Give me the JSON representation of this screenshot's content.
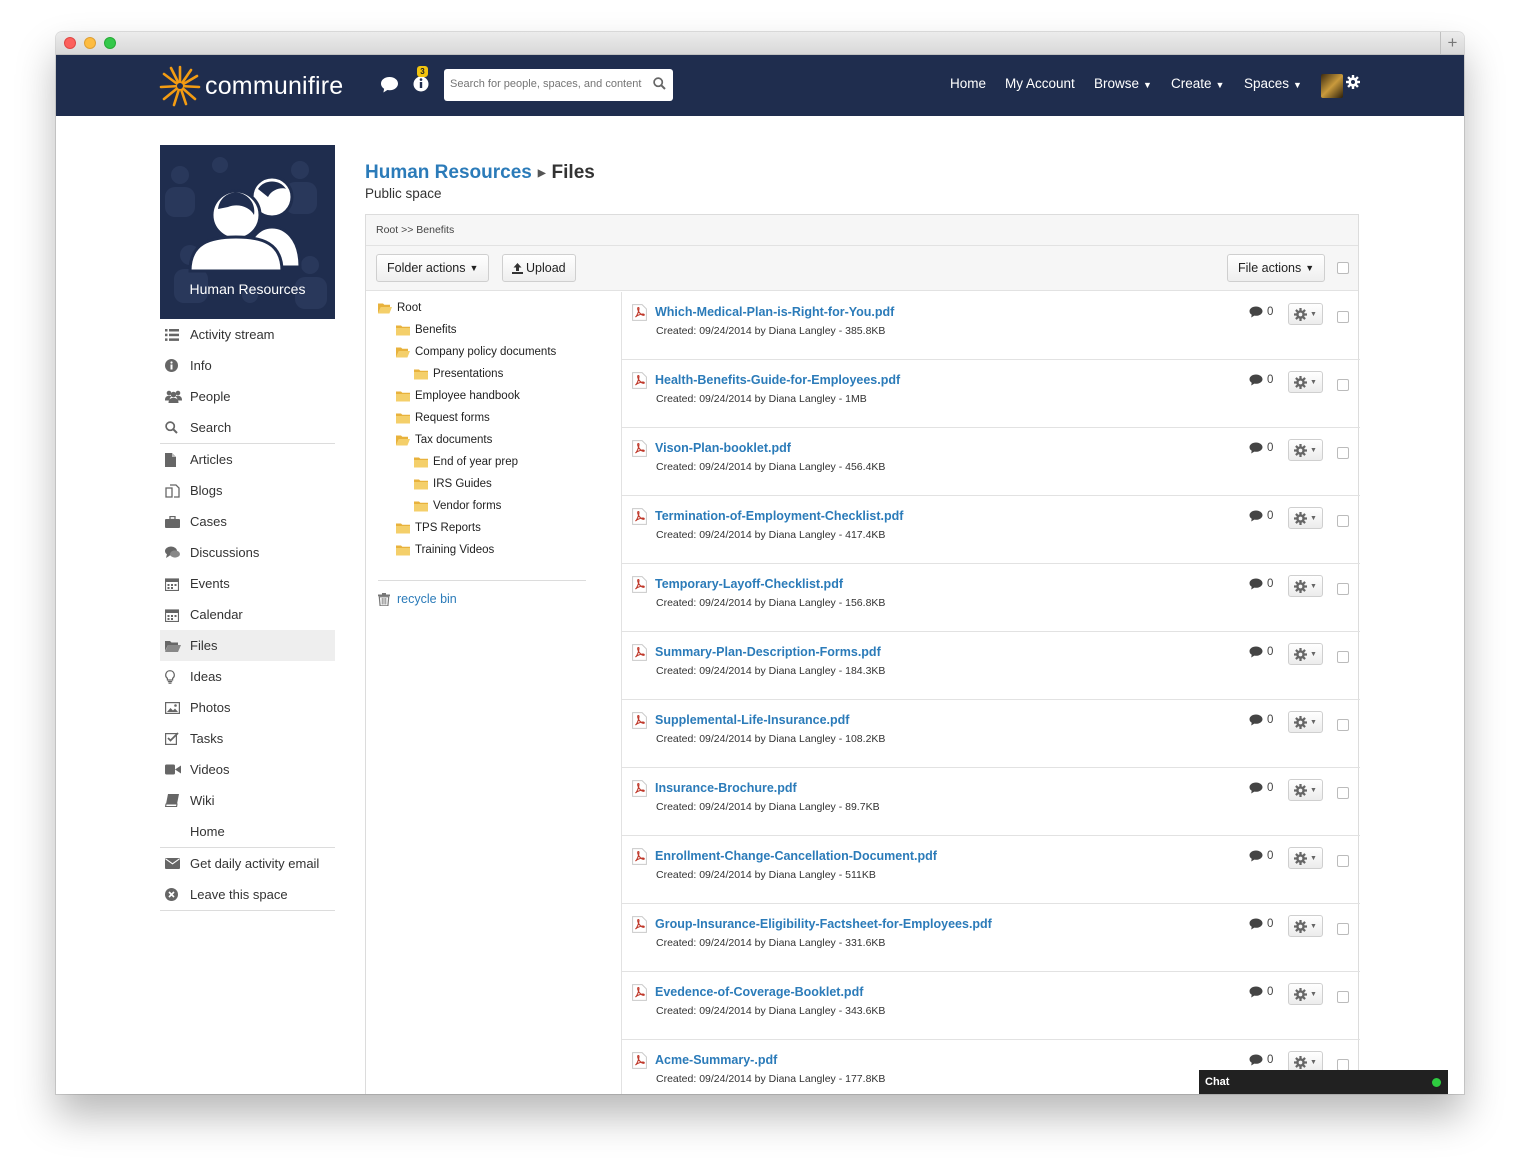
{
  "window": {
    "new_tab": "+"
  },
  "topnav": {
    "logo_text": "communifire",
    "notification_count": "3",
    "search_placeholder": "Search for people, spaces, and content",
    "menu": [
      {
        "label": "Home"
      },
      {
        "label": "My Account"
      },
      {
        "label": "Browse"
      },
      {
        "label": "Create"
      },
      {
        "label": "Spaces"
      }
    ]
  },
  "space": {
    "name": "Human Resources",
    "heading_link": "Human Resources",
    "heading_current": "Files",
    "visibility": "Public space"
  },
  "sidebar": {
    "items": [
      {
        "label": "Activity stream",
        "icon": "list-icon"
      },
      {
        "label": "Info",
        "icon": "info-icon"
      },
      {
        "label": "People",
        "icon": "people-icon"
      },
      {
        "label": "Search",
        "icon": "search-icon"
      },
      {
        "label": "Articles",
        "icon": "document-icon"
      },
      {
        "label": "Blogs",
        "icon": "blog-icon"
      },
      {
        "label": "Cases",
        "icon": "briefcase-icon"
      },
      {
        "label": "Discussions",
        "icon": "comments-icon"
      },
      {
        "label": "Events",
        "icon": "calendar-icon"
      },
      {
        "label": "Calendar",
        "icon": "calendar-icon"
      },
      {
        "label": "Files",
        "icon": "folder-open-icon"
      },
      {
        "label": "Ideas",
        "icon": "lightbulb-icon"
      },
      {
        "label": "Photos",
        "icon": "photo-icon"
      },
      {
        "label": "Tasks",
        "icon": "checkbox-icon"
      },
      {
        "label": "Videos",
        "icon": "video-icon"
      },
      {
        "label": "Wiki",
        "icon": "book-icon"
      },
      {
        "label": "Home",
        "icon": ""
      }
    ],
    "bottom": [
      {
        "label": "Get daily activity email",
        "icon": "envelope-icon"
      },
      {
        "label": "Leave this space",
        "icon": "remove-circle-icon"
      }
    ]
  },
  "toolbar": {
    "path": "Root >> Benefits",
    "folder_actions": "Folder actions",
    "upload": "Upload",
    "file_actions": "File actions"
  },
  "tree": {
    "items": [
      {
        "label": "Root",
        "open": true
      },
      {
        "label": "Benefits",
        "open": false
      },
      {
        "label": "Company policy documents",
        "open": true
      },
      {
        "label": "Presentations",
        "open": false
      },
      {
        "label": "Employee handbook",
        "open": false
      },
      {
        "label": "Request forms",
        "open": false
      },
      {
        "label": "Tax documents",
        "open": true
      },
      {
        "label": "End of year prep",
        "open": false
      },
      {
        "label": "IRS Guides",
        "open": false
      },
      {
        "label": "Vendor forms",
        "open": false
      },
      {
        "label": "TPS Reports",
        "open": false
      },
      {
        "label": "Training Videos",
        "open": false
      }
    ],
    "recycle_bin": "recycle bin"
  },
  "files": [
    {
      "name": "Which-Medical-Plan-is-Right-for-You.pdf",
      "meta": "Created: 09/24/2014 by Diana Langley - 385.8KB",
      "comments": "0"
    },
    {
      "name": "Health-Benefits-Guide-for-Employees.pdf",
      "meta": "Created: 09/24/2014 by Diana Langley - 1MB",
      "comments": "0"
    },
    {
      "name": "Vison-Plan-booklet.pdf",
      "meta": "Created: 09/24/2014 by Diana Langley - 456.4KB",
      "comments": "0"
    },
    {
      "name": "Termination-of-Employment-Checklist.pdf",
      "meta": "Created: 09/24/2014 by Diana Langley - 417.4KB",
      "comments": "0"
    },
    {
      "name": "Temporary-Layoff-Checklist.pdf",
      "meta": "Created: 09/24/2014 by Diana Langley - 156.8KB",
      "comments": "0"
    },
    {
      "name": "Summary-Plan-Description-Forms.pdf",
      "meta": "Created: 09/24/2014 by Diana Langley - 184.3KB",
      "comments": "0"
    },
    {
      "name": "Supplemental-Life-Insurance.pdf",
      "meta": "Created: 09/24/2014 by Diana Langley - 108.2KB",
      "comments": "0"
    },
    {
      "name": "Insurance-Brochure.pdf",
      "meta": "Created: 09/24/2014 by Diana Langley - 89.7KB",
      "comments": "0"
    },
    {
      "name": "Enrollment-Change-Cancellation-Document.pdf",
      "meta": "Created: 09/24/2014 by Diana Langley - 511KB",
      "comments": "0"
    },
    {
      "name": "Group-Insurance-Eligibility-Factsheet-for-Employees.pdf",
      "meta": "Created: 09/24/2014 by Diana Langley - 331.6KB",
      "comments": "0"
    },
    {
      "name": "Evedence-of-Coverage-Booklet.pdf",
      "meta": "Created: 09/24/2014 by Diana Langley - 343.6KB",
      "comments": "0"
    },
    {
      "name": "Acme-Summary-.pdf",
      "meta": "Created: 09/24/2014 by Diana Langley - 177.8KB",
      "comments": "0"
    }
  ],
  "chat": {
    "label": "Chat"
  },
  "colors": {
    "nav_bg": "#1f2d4e",
    "link": "#2b7bb9",
    "online": "#2ecc40",
    "pdf": "#c0392b"
  }
}
